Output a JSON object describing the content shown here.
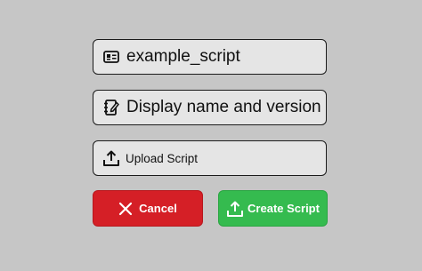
{
  "form": {
    "script_name": {
      "value": "example_script",
      "icon": "id-card-icon"
    },
    "display_name": {
      "value": "Display name and version",
      "icon": "notebook-icon"
    },
    "upload": {
      "label": "Upload Script",
      "icon": "upload-icon"
    }
  },
  "actions": {
    "cancel": {
      "label": "Cancel",
      "icon": "close-icon",
      "color": "#d51f26"
    },
    "create": {
      "label": "Create Script",
      "icon": "upload-icon",
      "color": "#35bb4f"
    }
  }
}
